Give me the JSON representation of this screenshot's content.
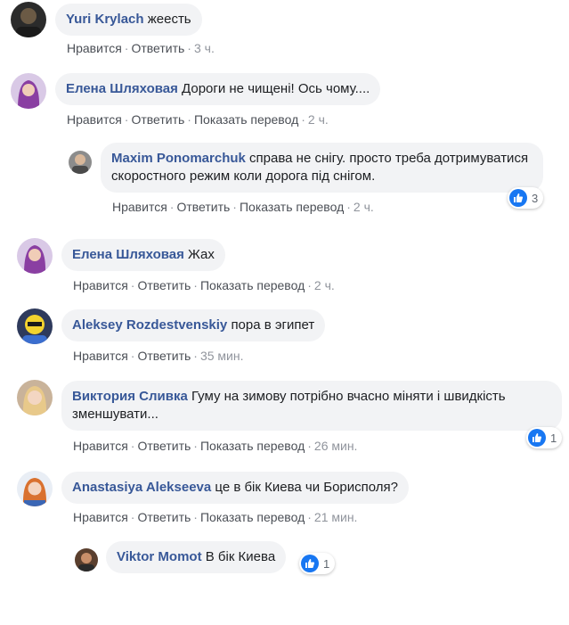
{
  "actions": {
    "like": "Нравится",
    "reply": "Ответить",
    "translate": "Показать перевод",
    "dot": "·"
  },
  "comments": [
    {
      "author": "Yuri Krylach",
      "text": "жеесть",
      "time": "3 ч.",
      "avatar": "avatar-dark-man"
    },
    {
      "author": "Елена Шляховая",
      "text": "Дороги не чищені! Ось чому....",
      "time": "2 ч.",
      "avatar": "avatar-woman-purple"
    },
    {
      "author": "Maxim Ponomarchuk",
      "text": "справа не снігу. просто треба дотримуватися скоростного режим коли дорога під снігом.",
      "time": "2 ч.",
      "reactions": "3",
      "avatar": "avatar-man-bald"
    },
    {
      "author": "Елена Шляховая",
      "text": "Жах",
      "time": "2 ч.",
      "avatar": "avatar-woman-purple"
    },
    {
      "author": "Aleksey Rozdestvenskiy",
      "text": "пора в эгипет",
      "time": "35 мин.",
      "avatar": "avatar-yellow-mask"
    },
    {
      "author": "Виктория Сливка",
      "text": "Гуму на зимову потрібно вчасно міняти і швидкість зменшувати...",
      "time": "26 мин.",
      "reactions": "1",
      "avatar": "avatar-woman-blonde"
    },
    {
      "author": "Anastasiya Alekseeva",
      "text": "це в бік Киева чи Борисполя?",
      "time": "21 мин.",
      "avatar": "avatar-woman-red-hair"
    },
    {
      "author": "Viktor Momot",
      "text": "В бік Киева",
      "reactions": "1",
      "avatar": "avatar-man-dark"
    }
  ],
  "colors": {
    "author": "#385898",
    "bubble": "#f2f3f5",
    "like": "#1877f2"
  }
}
